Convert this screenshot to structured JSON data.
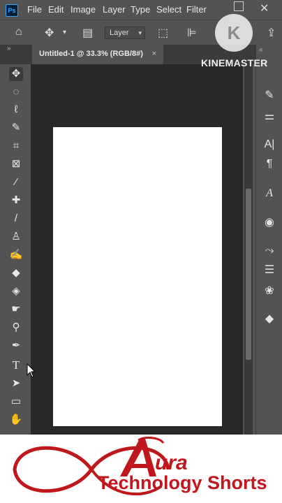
{
  "app": {
    "logo_text": "Ps"
  },
  "menu": {
    "items": [
      "File",
      "Edit",
      "Image",
      "Layer",
      "Type",
      "Select",
      "Filter"
    ]
  },
  "options_bar": {
    "layer_select_value": "Layer"
  },
  "document_tab": {
    "title": "Untitled-1 @ 33.3% (RGB/8#)",
    "close_glyph": "×"
  },
  "tools": [
    "move-tool",
    "elliptical-marquee-tool",
    "lasso-tool",
    "quick-selection-tool",
    "crop-tool",
    "frame-tool",
    "eyedropper-tool",
    "spot-healing-brush-tool",
    "brush-tool",
    "clone-stamp-tool",
    "history-brush-tool",
    "eraser-tool",
    "paint-bucket-tool",
    "smudge-tool",
    "dodge-tool",
    "pen-tool",
    "type-tool",
    "path-selection-tool",
    "rectangle-tool",
    "hand-tool"
  ],
  "type_tool_label": "T",
  "right_panel": {
    "character_label": "A|",
    "paragraph_label": "¶",
    "glyphs_label": "A"
  },
  "watermark": {
    "circle_letter": "K",
    "text": "KINEMASTER"
  },
  "banner": {
    "brand": "ura",
    "brand_initial": "A",
    "subtitle": "Technology Shorts",
    "brand_color": "#c0171c"
  },
  "colors": {
    "ui_bg": "#535353",
    "canvas_bg": "#282828",
    "accent": "#31a8ff"
  }
}
